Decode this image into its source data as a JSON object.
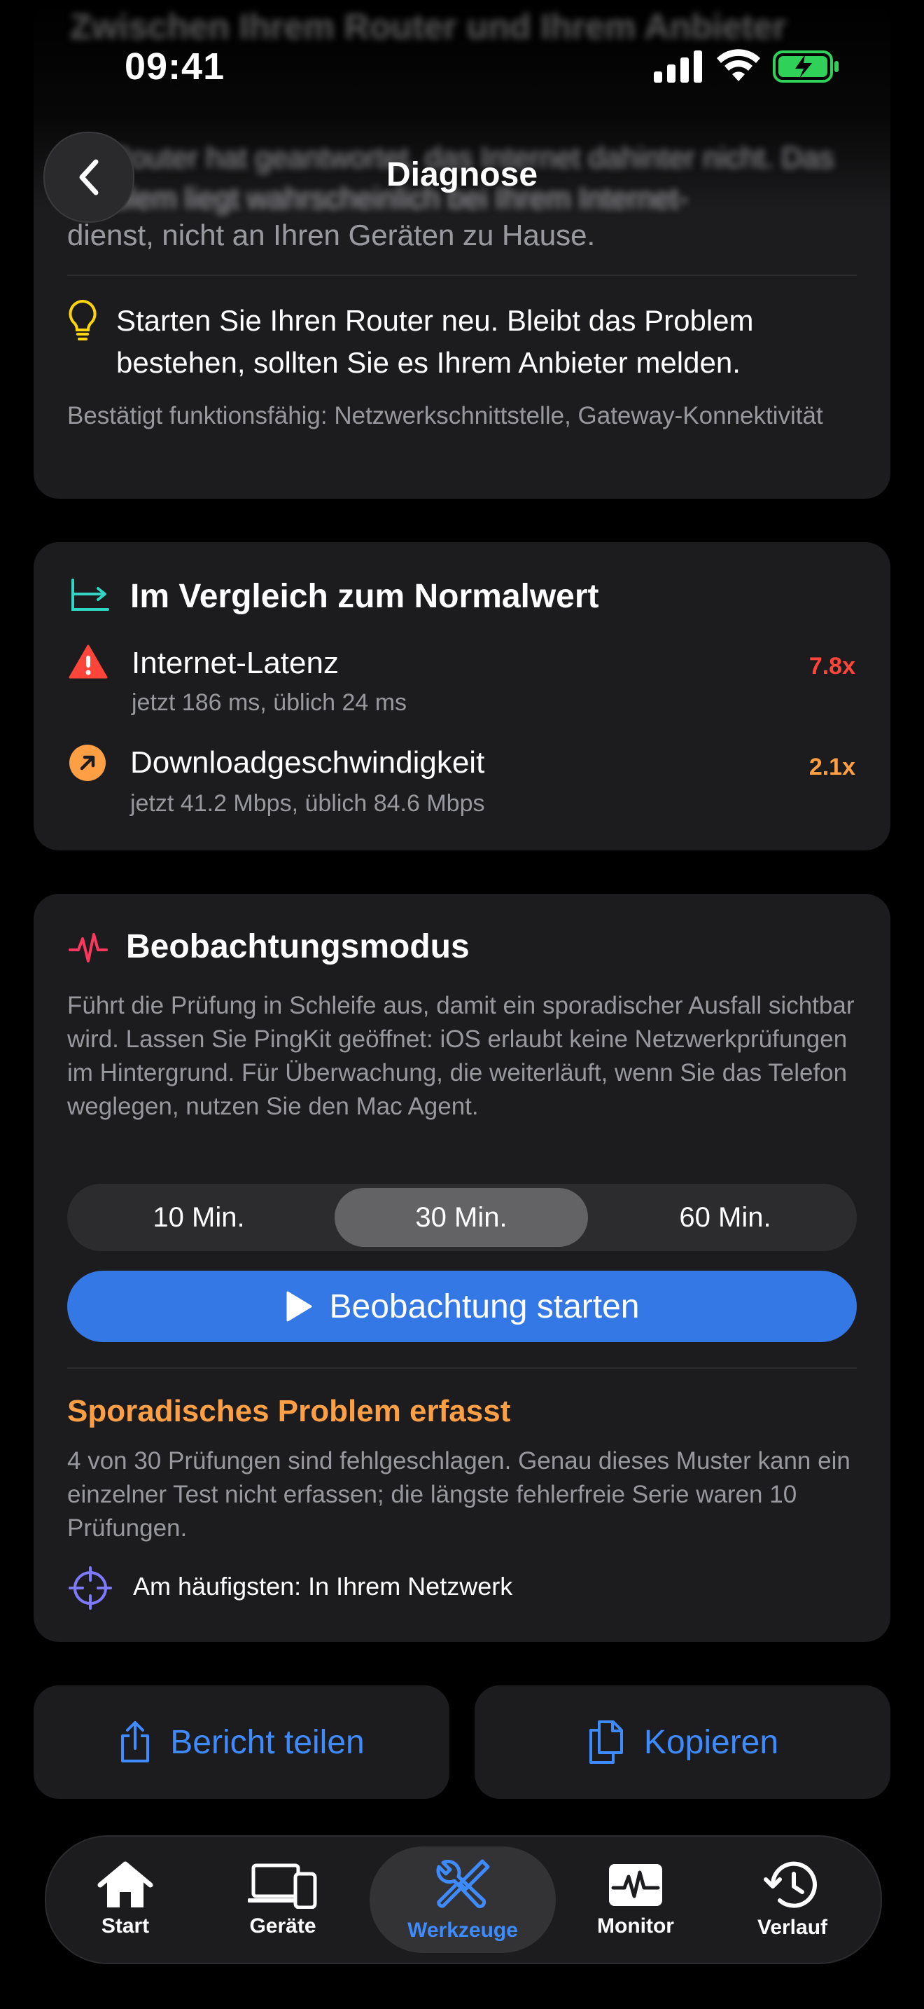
{
  "status": {
    "time": "09:41"
  },
  "header": {
    "blurred_heading": "Zwischen Ihrem Router und Ihrem Anbieter",
    "blurred_text": "Ihr Router hat geantwortet, das Internet dahinter nicht. Das Problem liegt wahrscheinlich bei Ihrem Internet-",
    "blurred_text_end": "dienst, nicht an Ihren Geräten zu Hause.",
    "title": "Diagnose"
  },
  "diagnosis": {
    "tip": "Starten Sie Ihren Router neu. Bleibt das Problem bestehen, sollten Sie es Ihrem Anbieter melden.",
    "confirmed": "Bestätigt funktionsfähig: Netzwerkschnittstelle, Gateway-Konnektivität"
  },
  "comparison": {
    "title": "Im Vergleich zum Normalwert",
    "rows": [
      {
        "title": "Internet-Latenz",
        "sub": "jetzt 186 ms, üblich 24 ms",
        "ratio": "7.8x",
        "color": "#ff453a"
      },
      {
        "title": "Downloadgeschwindigkeit",
        "sub": "jetzt 41.2 Mbps, üblich 84.6 Mbps",
        "ratio": "2.1x",
        "color": "#ff9f43"
      }
    ]
  },
  "watch": {
    "title": "Beobachtungsmodus",
    "description": "Führt die Prüfung in Schleife aus, damit ein sporadischer Ausfall sichtbar wird. Lassen Sie PingKit geöffnet: iOS erlaubt keine Netzwerkprüfungen im Hintergrund. Für Überwachung, die weiterläuft, wenn Sie das Telefon weglegen, nutzen Sie den Mac Agent.",
    "options": [
      "10 Min.",
      "30 Min.",
      "60 Min."
    ],
    "selected": "30 Min.",
    "start_label": "Beobachtung starten",
    "issue_title": "Sporadisches Problem erfasst",
    "issue_desc": "4 von 30 Prüfungen sind fehlgeschlagen. Genau dieses Muster kann ein einzelner Test nicht erfassen; die längste fehlerfreie Serie waren 10 Prüfungen.",
    "most_common": "Am häufigsten: In Ihrem Netzwerk"
  },
  "actions": {
    "share": "Bericht teilen",
    "copy": "Kopieren"
  },
  "tabs": [
    "Start",
    "Geräte",
    "Werkzeuge",
    "Monitor",
    "Verlauf"
  ],
  "active_tab": "Werkzeuge",
  "colors": {
    "accent": "#3d8bff",
    "warning": "#ff9f43",
    "error": "#ff453a",
    "teal": "#30d6c3"
  }
}
